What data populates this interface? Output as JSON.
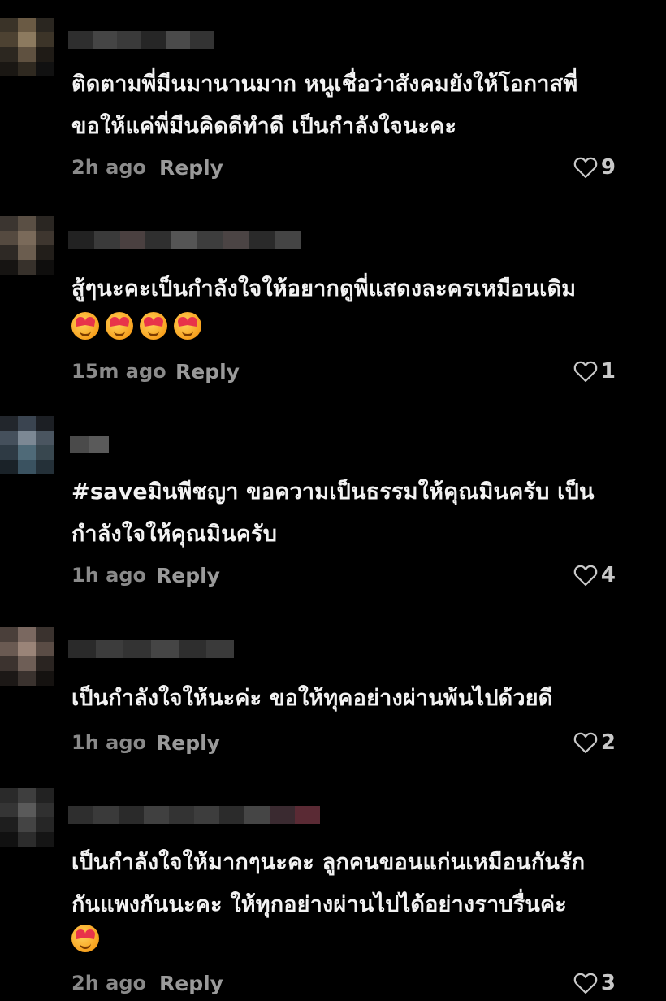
{
  "comments": [
    {
      "text": "ติดตามพี่มีนมานานมาก หนูเชื่อว่าสังคมยังให้โอกาสพี่\nขอให้แค่พี่มีนคิดดีทำดี เป็นกำลังใจนะคะ",
      "time": "2h ago",
      "reply": "Reply",
      "likes": "9",
      "emojis": []
    },
    {
      "text": "สู้ๆนะคะเป็นกำลังใจให้อยากดูพี่แสดงละครเหมือนเดิม",
      "time": "15m ago",
      "reply": "Reply",
      "likes": "1",
      "emojis": [
        "smiling-face-with-hearts",
        "smiling-face-with-hearts",
        "smiling-face-with-hearts",
        "smiling-face-with-hearts"
      ]
    },
    {
      "text": "#saveมินพีชญา ขอความเป็นธรรมให้คุณมินครับ เป็น\nกำลังใจให้คุณมินครับ",
      "time": "1h ago",
      "reply": "Reply",
      "likes": "4",
      "emojis": []
    },
    {
      "text": "เป็นกำลังใจให้นะค่ะ ขอให้ทุคอย่างผ่านพ้นไปด้วยดี",
      "time": "1h ago",
      "reply": "Reply",
      "likes": "2",
      "emojis": []
    },
    {
      "text": "เป็นกำลังใจให้มากๆนะคะ ลูกคนขอนแก่นเหมือนกันรัก\nกันแพงกันนะคะ ให้ทุกอย่างผ่านไปได้อย่างราบรื่นค่ะ",
      "time": "2h ago",
      "reply": "Reply",
      "likes": "3",
      "emojis": [
        "smiling-face-with-hearts"
      ]
    }
  ],
  "icons": {
    "like": "heart-outline-icon",
    "emoji": "smiling-face-with-hearts"
  },
  "colors": {
    "background": "#000000",
    "text": "#f2f2f2",
    "meta": "#8a8a8a"
  }
}
